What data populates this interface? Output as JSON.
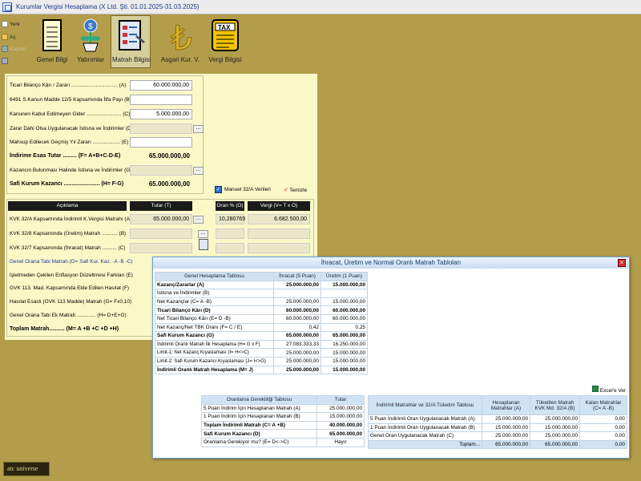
{
  "app": {
    "title": "Kurumlar Vergisi Hesaplama (X Ltd. Şti. 01.01.2025-31.03.2025)"
  },
  "sidebar": [
    {
      "label": "Yeni",
      "icon": "new-doc-icon"
    },
    {
      "label": "Aç",
      "icon": "folder-open-icon"
    },
    {
      "label": "Kaydet",
      "icon": "save-icon"
    },
    {
      "label": "",
      "icon": "print-icon"
    }
  ],
  "toolbar": [
    {
      "label": "Genel Bilgi",
      "icon": "notepad-icon"
    },
    {
      "label": "Yatırımlar",
      "icon": "money-plant-icon"
    },
    {
      "label": "Matrah Bilgisi",
      "icon": "form-clipboard-icon"
    },
    {
      "label": "Asgari Kur. V.",
      "icon": "lira-icon"
    },
    {
      "label": "Vergi Bilgisi",
      "icon": "tax-form-icon"
    }
  ],
  "form": {
    "rows": [
      {
        "label": "Ticari Bilanço Kârı / Zararı ................................ (A)",
        "value": "60.000.000,00"
      },
      {
        "label": "6491 S.Kanun Madde 12/5 Kapsamında İtfa Payı (B)",
        "value": ""
      },
      {
        "label": "Kanunen Kabul Edilmeyen Gider ........................ (C)",
        "value": "5.000.000,00"
      },
      {
        "label": "Zarar Dahi Olsa Uygulanacak İstisna ve İndirimler (D)",
        "value": ""
      },
      {
        "label": "Mahsup Edilecek Geçmiş Yıl Zararı ................... (E)",
        "value": ""
      },
      {
        "label": "İndirime Esas Tutar ......... (F= A+B+C-D-E)",
        "value": "65.000.000,00"
      },
      {
        "label": "Kazancın Bulunması Halinde İstisna ve İndirimler (G)",
        "value": ""
      },
      {
        "label": "Safi Kurum Kazancı ....................... (H= F-G)",
        "value": "65.000.000,00"
      }
    ],
    "manuel_label": "Manuel 32/A Verileri",
    "temizle_label": "Temizle"
  },
  "lower": {
    "headers": [
      "Açıklama",
      "Tutar (T)",
      "Oran % (O)",
      "Vergi (V= T x O)"
    ],
    "rows": [
      {
        "label": "KVK 32/A Kapsamında İndirimli K.Vergisi Matrahı (A)",
        "t": "65.000.000,00",
        "o": "10,280769",
        "v": "6.682.500,00"
      },
      {
        "label": "KVK 32/8 Kapsamında (Üretim) Matrah ........... (B)",
        "t": "",
        "o": "",
        "v": ""
      },
      {
        "label": "KVK 32/7 Kapsamında (İhracat) Matrah .......... (C)",
        "t": "",
        "o": "",
        "v": ""
      },
      {
        "label": "Genel Orana Tabi Matrah (D= Safi Kur. Kaz. -A -B -C)",
        "t": "",
        "o": "",
        "v": ""
      },
      {
        "label": "İşletmeden Çekilen Enflasyon Düzeltmesi Farkları (E)",
        "t": "",
        "o": "",
        "v": ""
      },
      {
        "label": "GVK 113. Mad. Kapsamında Elde Edilen Hasılat (F)",
        "t": "",
        "o": "",
        "v": ""
      },
      {
        "label": "Hasılat Esaslı (GVK 113 Madde) Matrah (G= Fx0,10)",
        "t": "",
        "o": "",
        "v": ""
      },
      {
        "label": "Genel Orana Tabi Ek Matrah ............. (H= D+E+G)",
        "t": "",
        "o": "",
        "v": ""
      },
      {
        "label": "Toplam Matrah.......... (M= A +B +C +D +H)",
        "t": "",
        "o": "",
        "v": ""
      }
    ]
  },
  "dialog": {
    "title": "İhracat, Üretim ve Normal Oranlı Matrah Tabloları",
    "t1": {
      "headers": [
        "Genel Hesaplama Tablosu",
        "İhracat (5 Puan)",
        "Üretim (1 Puan)"
      ],
      "rows": [
        [
          "Kazanç/Zararlar (A)",
          "25.000.000,00",
          "15.000.000,00"
        ],
        [
          "İstisna ve İndirimler (B)",
          "",
          ""
        ],
        [
          "Net Kazançlar (C= A -B)",
          "25.000.000,00",
          "15.000.000,00"
        ],
        [
          "Ticari Bilanço Kârı (D)",
          "60.000.000,00",
          "60.000.000,00"
        ],
        [
          "Net Ticari Bilanço Kârı (E= D -B)",
          "60.000.000,00",
          "60.000.000,00"
        ],
        [
          "Net Kazanç/Net TBK Oranı (F= C / E)",
          "0,42",
          "0,25"
        ],
        [
          "Safi Kurum Kazancı (G)",
          "65.000.000,00",
          "65.000.000,00"
        ],
        [
          "İndirimli Oranlı Matrah İlk Hesaplama (H= G x F)",
          "27.083.333,33",
          "16.250.000,00"
        ],
        [
          "Limit-1: Net Kazanç Kıyaslaması (I= H<>C)",
          "25.000.000,00",
          "15.000.000,00"
        ],
        [
          "Limit-2: Safi Kurum Kazancı Kıyaslaması (J= I<>G)",
          "25.000.000,00",
          "15.000.000,00"
        ],
        [
          "İndirimli Oranlı Matrah Hesaplama (M= J)",
          "25.000.000,00",
          "15.000.000,00"
        ]
      ]
    },
    "excel_label": "Excel'e Ver",
    "t2": {
      "headers": [
        "Oranlama Gerekliliği Tablosu",
        "Tutar"
      ],
      "rows": [
        [
          "5 Puan İndirim İçin Hesaplanan Matrah (A)",
          "25.000.000,00"
        ],
        [
          "1 Puan İndirim İçin Hesaplanan Matrah (B)",
          "15.000.000,00"
        ],
        [
          "Toplam İndirimli Matrah (C= A +B)",
          "40.000.000,00"
        ],
        [
          "Safi Kurum Kazancı (D)",
          "65.000.000,00"
        ],
        [
          "Oranlama Gerekiyor mu? (E= D<->C)",
          "Hayır"
        ]
      ]
    },
    "t3": {
      "headers": [
        "İndirimli Matrahlar ve 32/A Tüketim Tablosu",
        "Hesaplanan Matrahlar (A)",
        "Tüketilen Matrah KVK Md. 32/A (B)",
        "Kalan Matrahlar (C= A -B)"
      ],
      "rows": [
        [
          "5 Puan İndirimli Oran Uygulanacak Matrah (A)",
          "25.000.000,00",
          "25.000.000,00",
          "0,00"
        ],
        [
          "1 Puan İndirimli Oran Uygulanacak Matrah (B)",
          "15.000.000,00",
          "15.000.000,00",
          "0,00"
        ],
        [
          "Genel Oran Uygulanacak Matrah (C)",
          "25.000.000,00",
          "25.000.000,00",
          "0,00"
        ],
        [
          "Toplam...",
          "65.000.000,00",
          "65.000.000,00",
          "0,00"
        ]
      ]
    }
  },
  "brand": "atc universe"
}
